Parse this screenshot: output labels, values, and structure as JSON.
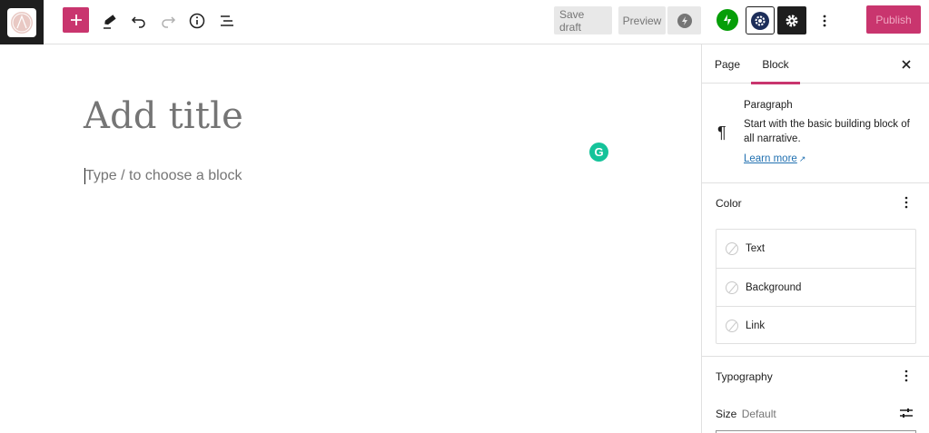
{
  "toolbar": {
    "site_logo": "site-logo",
    "save_draft": "Save draft",
    "preview": "Preview",
    "publish": "Publish",
    "icons": [
      "plus-icon",
      "pencil-icon",
      "undo-icon",
      "redo-icon",
      "info-icon",
      "list-view-icon",
      "jetpack-bolt-icon",
      "jetpack-icon",
      "block-settings-icon",
      "gear-icon",
      "more-vertical-icon"
    ]
  },
  "editor": {
    "title_placeholder": "Add title",
    "block_placeholder": "Type / to choose a block",
    "grammarly_letter": "G"
  },
  "sidebar": {
    "tabs": [
      {
        "label": "Page",
        "active": false
      },
      {
        "label": "Block",
        "active": true
      }
    ],
    "block_card": {
      "icon": "¶",
      "title": "Paragraph",
      "description": "Start with the basic building block of all narrative.",
      "link": "Learn more"
    },
    "color_panel": {
      "title": "Color",
      "items": [
        {
          "label": "Text"
        },
        {
          "label": "Background"
        },
        {
          "label": "Link"
        }
      ]
    },
    "typography_panel": {
      "title": "Typography",
      "size_label": "Size",
      "size_value": "Default"
    }
  },
  "colors": {
    "accent": "#c9356e",
    "jetpack_green": "#069e08",
    "grammarly": "#15c39a",
    "link": "#2271b1"
  }
}
